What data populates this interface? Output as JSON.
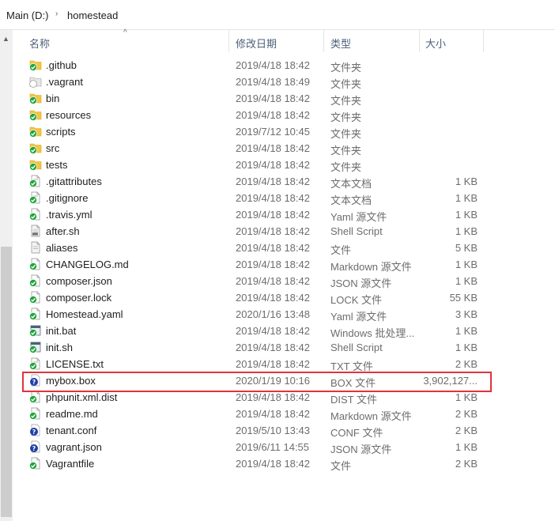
{
  "breadcrumb": [
    "Main (D:)",
    "homestead"
  ],
  "columns": {
    "name": "名称",
    "modified": "修改日期",
    "type": "类型",
    "size": "大小"
  },
  "files": [
    {
      "name": ".github",
      "modified": "2019/4/18 18:42",
      "type": "文件夹",
      "size": "",
      "icon": "folder-icon"
    },
    {
      "name": ".vagrant",
      "modified": "2019/4/18 18:49",
      "type": "文件夹",
      "size": "",
      "icon": "folder-gray-icon"
    },
    {
      "name": "bin",
      "modified": "2019/4/18 18:42",
      "type": "文件夹",
      "size": "",
      "icon": "folder-icon"
    },
    {
      "name": "resources",
      "modified": "2019/4/18 18:42",
      "type": "文件夹",
      "size": "",
      "icon": "folder-icon"
    },
    {
      "name": "scripts",
      "modified": "2019/7/12 10:45",
      "type": "文件夹",
      "size": "",
      "icon": "folder-icon"
    },
    {
      "name": "src",
      "modified": "2019/4/18 18:42",
      "type": "文件夹",
      "size": "",
      "icon": "folder-icon"
    },
    {
      "name": "tests",
      "modified": "2019/4/18 18:42",
      "type": "文件夹",
      "size": "",
      "icon": "folder-icon"
    },
    {
      "name": ".gitattributes",
      "modified": "2019/4/18 18:42",
      "type": "文本文档",
      "size": "1 KB",
      "icon": "text-file-icon"
    },
    {
      "name": ".gitignore",
      "modified": "2019/4/18 18:42",
      "type": "文本文档",
      "size": "1 KB",
      "icon": "text-file-icon"
    },
    {
      "name": ".travis.yml",
      "modified": "2019/4/18 18:42",
      "type": "Yaml 源文件",
      "size": "1 KB",
      "icon": "yaml-file-icon"
    },
    {
      "name": "after.sh",
      "modified": "2019/4/18 18:42",
      "type": "Shell Script",
      "size": "1 KB",
      "icon": "script-file-icon"
    },
    {
      "name": "aliases",
      "modified": "2019/4/18 18:42",
      "type": "文件",
      "size": "5 KB",
      "icon": "file-gray-icon"
    },
    {
      "name": "CHANGELOG.md",
      "modified": "2019/4/18 18:42",
      "type": "Markdown 源文件",
      "size": "1 KB",
      "icon": "file-icon"
    },
    {
      "name": "composer.json",
      "modified": "2019/4/18 18:42",
      "type": "JSON 源文件",
      "size": "1 KB",
      "icon": "file-icon"
    },
    {
      "name": "composer.lock",
      "modified": "2019/4/18 18:42",
      "type": "LOCK 文件",
      "size": "55 KB",
      "icon": "file-icon"
    },
    {
      "name": "Homestead.yaml",
      "modified": "2020/1/16 13:48",
      "type": "Yaml 源文件",
      "size": "3 KB",
      "icon": "file-icon"
    },
    {
      "name": "init.bat",
      "modified": "2019/4/18 18:42",
      "type": "Windows 批处理...",
      "size": "1 KB",
      "icon": "batch-file-icon"
    },
    {
      "name": "init.sh",
      "modified": "2019/4/18 18:42",
      "type": "Shell Script",
      "size": "1 KB",
      "icon": "batch-file-icon"
    },
    {
      "name": "LICENSE.txt",
      "modified": "2019/4/18 18:42",
      "type": "TXT 文件",
      "size": "2 KB",
      "icon": "text-file-icon"
    },
    {
      "name": "mybox.box",
      "modified": "2020/1/19 10:16",
      "type": "BOX 文件",
      "size": "3,902,127...",
      "icon": "unknown-file-icon"
    },
    {
      "name": "phpunit.xml.dist",
      "modified": "2019/4/18 18:42",
      "type": "DIST 文件",
      "size": "1 KB",
      "icon": "file-icon"
    },
    {
      "name": "readme.md",
      "modified": "2019/4/18 18:42",
      "type": "Markdown 源文件",
      "size": "2 KB",
      "icon": "file-icon"
    },
    {
      "name": "tenant.conf",
      "modified": "2019/5/10 13:43",
      "type": "CONF 文件",
      "size": "2 KB",
      "icon": "unknown-file-icon"
    },
    {
      "name": "vagrant.json",
      "modified": "2019/6/11 14:55",
      "type": "JSON 源文件",
      "size": "1 KB",
      "icon": "unknown-file-icon"
    },
    {
      "name": "Vagrantfile",
      "modified": "2019/4/18 18:42",
      "type": "文件",
      "size": "2 KB",
      "icon": "file-icon"
    }
  ],
  "colors": {
    "highlight": "#e0333a",
    "folder": "#f5c542",
    "check": "#21a63b"
  }
}
